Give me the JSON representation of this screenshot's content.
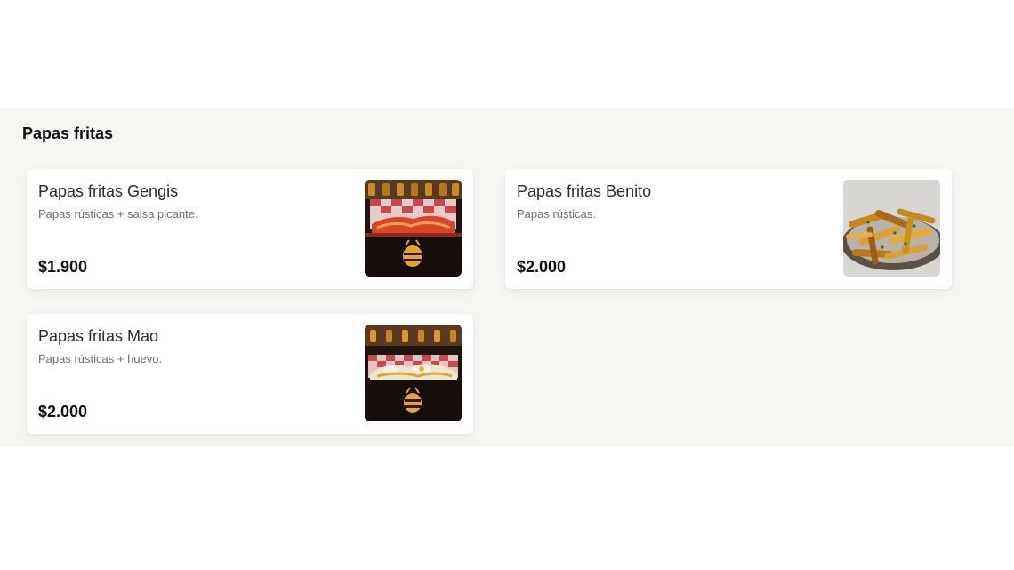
{
  "section": {
    "title": "Papas fritas"
  },
  "items": [
    {
      "name": "Papas fritas Gengis",
      "description": "Papas rústicas + salsa picante.",
      "price": "$1.900",
      "image_icon": "spicy-fries-photo"
    },
    {
      "name": "Papas fritas Benito",
      "description": "Papas rústicas.",
      "price": "$2.000",
      "image_icon": "rustic-fries-photo"
    },
    {
      "name": "Papas fritas Mao",
      "description": "Papas rústicas + huevo.",
      "price": "$2.000",
      "image_icon": "egg-fries-photo"
    }
  ],
  "colors": {
    "section_background": "#f8f6f3",
    "card_background": "#ffffff",
    "text_primary": "#111111",
    "text_secondary": "#6f6f6f"
  }
}
